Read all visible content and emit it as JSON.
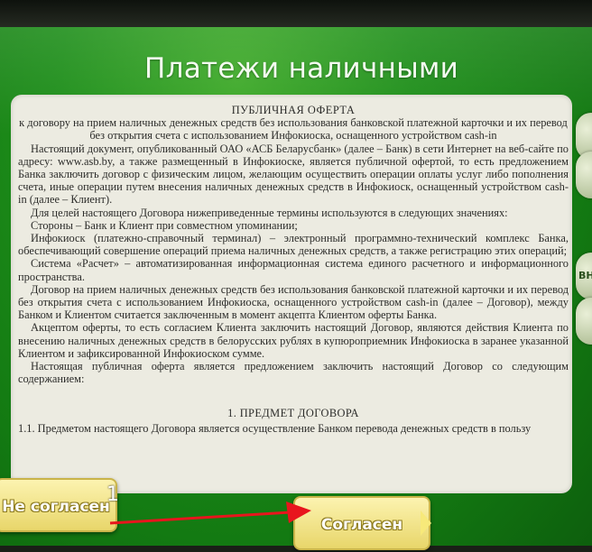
{
  "screen": {
    "title": "Платежи наличными"
  },
  "document": {
    "heading_1": "ПУБЛИЧНАЯ ОФЕРТА",
    "heading_2": "к договору на прием наличных денежных средств без использования банковской платежной карточки и их перевод без открытия счета с использованием Инфокиоска, оснащенного устройством cash-in",
    "paragraphs": [
      "Настоящий документ, опубликованный ОАО «АСБ Беларусбанк» (далее – Банк) в сети Интернет на веб-сайте по адресу: www.asb.by, а также размещенный в Инфокиоске, является публичной офертой, то есть предложением Банка заключить договор с физическим лицом, желающим осуществить операции оплаты услуг либо пополнения счета, иные операции путем внесения наличных денежных средств в Инфокиоск, оснащенный устройством cash-in (далее – Клиент).",
      "Для целей настоящего Договора нижеприведенные термины используются в следующих значениях:",
      "Стороны – Банк и Клиент при совместном упоминании;",
      "Инфокиоск (платежно-справочный терминал) – электронный программно-технический комплекс Банка, обеспечивающий совершение операций приема наличных денежных средств, а также регистрацию этих операций;",
      "Система «Расчет» – автоматизированная информационная система единого расчетного и информационного пространства.",
      "Договор на прием наличных денежных средств без использования банковской платежной карточки и их перевод без открытия счета с использованием Инфокиоска, оснащенного устройством cash-in (далее – Договор), между Банком и Клиентом считается заключенным в момент акцепта Клиентом оферты Банка.",
      "Акцептом оферты, то есть согласием Клиента заключить настоящий Договор, являются действия Клиента по внесению наличных денежных средств в белорусских рублях в купюроприемник Инфокиоска в заранее указанной Клиентом и зафиксированной Инфокиоском сумме.",
      "Настоящая публичная оферта является предложением заключить настоящий Договор со следующим содержанием:"
    ],
    "section_title": "1. ПРЕДМЕТ ДОГОВОРА",
    "section_text": "1.1. Предметом настоящего Договора является осуществление Банком перевода денежных средств в пользу"
  },
  "side_buttons": {
    "top_label": "",
    "middle_label": "ВН",
    "bottom_label": ""
  },
  "buttons": {
    "disagree_label": "Не согласен",
    "agree_label": "Согласен"
  },
  "annotation": {
    "number": "1",
    "arrow_color": "#e8151d"
  }
}
